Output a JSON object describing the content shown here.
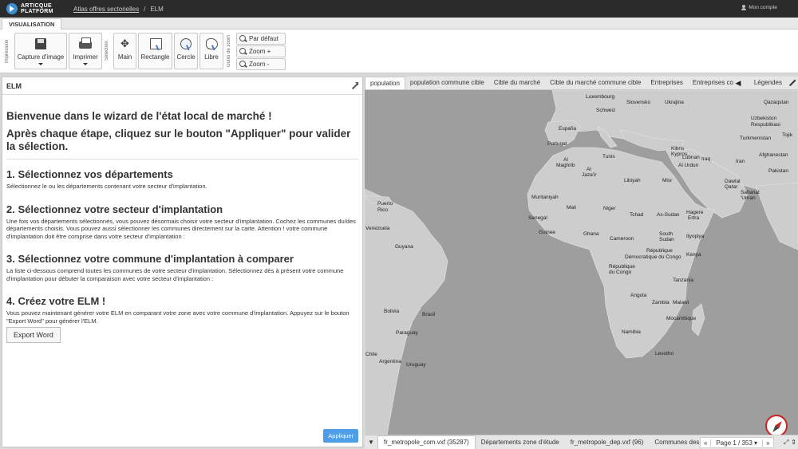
{
  "topbar": {
    "logo_line1": "ARTICQUE",
    "logo_line2": "PLATFORM",
    "breadcrumb": [
      "Atlas offres sectorielles",
      "/",
      "ELM"
    ],
    "account": "Mon compte"
  },
  "ribbon": {
    "tab": "VISUALISATION",
    "group_print": "Impression",
    "group_selection": "Sélection",
    "group_zoom": "Outils de zoom",
    "capture": "Capture d'image",
    "print": "Imprimer",
    "main": "Main",
    "rectangle": "Rectangle",
    "cercle": "Cercle",
    "libre": "Libre",
    "zoom_default": "Par défaut",
    "zoom_in": "Zoom +",
    "zoom_out": "Zoom -"
  },
  "panel": {
    "title": "ELM",
    "welcome": "Bienvenue dans le wizard de l'état local de marché !",
    "instructions": "Après chaque étape, cliquez sur le bouton \"Appliquer\" pour valider la sélection.",
    "steps": [
      {
        "title": "1. Sélectionnez vos départements",
        "text": "Sélectionnez le ou les départements contenant votre secteur d'implantation."
      },
      {
        "title": "2. Sélectionnez votre secteur d'implantation",
        "text": "Une fois vos départements sélectionnés, vous pouvez désormais choisir votre secteur d'implantation. Cochez les communes du/des départements choisis. Vous pouvez aussi sélectionner les communes directement sur la carte. Attention ! votre commune d'implantation doit être comprise dans votre secteur d'implantation :"
      },
      {
        "title": "3. Sélectionnez votre commune d'implantation à comparer",
        "text": "La liste ci-dessous comprend toutes les communes de votre secteur d'implantation. Sélectionnez dès à présent votre commune d'implantation pour débuter la comparaison avec votre secteur d'implantation :"
      },
      {
        "title": "4. Créez votre ELM !",
        "text": "Vous pouvez maintenant générer votre ELM en comparant votre zone avec votre commune d'implantation. Appuyez sur le bouton \"Export Word\" pour générer l'ELM."
      }
    ],
    "export_label": "Export Word",
    "apply_label": "Appliquer"
  },
  "map_tabs": [
    "population",
    "population commune cible",
    "Cible du marché",
    "Cible du marché commune cible",
    "Entreprises",
    "Entreprises co"
  ],
  "legend_tab": "Légendes",
  "places": [
    {
      "name": "Luxembourg"
    },
    {
      "name": "Slovensko"
    },
    {
      "name": "Ukrajina"
    },
    {
      "name": "Qazaqstan"
    },
    {
      "name": "Schweiz"
    },
    {
      "name": "Uzbekiston"
    },
    {
      "name": "Respublikasi"
    },
    {
      "name": "España"
    },
    {
      "name": "Turkmenistan"
    },
    {
      "name": "Tojik"
    },
    {
      "name": "Portugal"
    },
    {
      "name": "Kibris"
    },
    {
      "name": "Kypros"
    },
    {
      "name": "Afghanestan"
    },
    {
      "name": "Tunis"
    },
    {
      "name": "Lubnan"
    },
    {
      "name": "Al"
    },
    {
      "name": "Maghrib"
    },
    {
      "name": "Al Urdun"
    },
    {
      "name": "Iraq"
    },
    {
      "name": "Iran"
    },
    {
      "name": "Al"
    },
    {
      "name": "Jaza'ir"
    },
    {
      "name": "Pakistan"
    },
    {
      "name": "Libiyah"
    },
    {
      "name": "Misr"
    },
    {
      "name": "Dawlat"
    },
    {
      "name": "Qatar"
    },
    {
      "name": "Saltanat"
    },
    {
      "name": "'Uman"
    },
    {
      "name": "Puerto"
    },
    {
      "name": "Rico"
    },
    {
      "name": "Muritaniyah"
    },
    {
      "name": "Mali"
    },
    {
      "name": "Niger"
    },
    {
      "name": "Senegal"
    },
    {
      "name": "Tchad"
    },
    {
      "name": "As-Sudan"
    },
    {
      "name": "Hagere"
    },
    {
      "name": "Ertra"
    },
    {
      "name": "Venezuela"
    },
    {
      "name": "Guinee"
    },
    {
      "name": "Ghana"
    },
    {
      "name": "South"
    },
    {
      "name": "Sudan"
    },
    {
      "name": "Cameroon"
    },
    {
      "name": "Ityopiya"
    },
    {
      "name": "Guyana"
    },
    {
      "name": "République"
    },
    {
      "name": "Démocratique du Congo"
    },
    {
      "name": "Kenya"
    },
    {
      "name": "République"
    },
    {
      "name": "du Congo"
    },
    {
      "name": "Tanzania"
    },
    {
      "name": "Angola"
    },
    {
      "name": "Zambia"
    },
    {
      "name": "Malawi"
    },
    {
      "name": "Bolivia"
    },
    {
      "name": "Brasil"
    },
    {
      "name": "Mocambique"
    },
    {
      "name": "Paraguay"
    },
    {
      "name": "Namibia"
    },
    {
      "name": "Chile"
    },
    {
      "name": "Lesotho"
    },
    {
      "name": "Argentina"
    },
    {
      "name": "Uruguay"
    }
  ],
  "layer_tabs": [
    "fr_metropole_com.vxf (35287)",
    "Départements zone d'étude",
    "fr_metropole_dep.vxf (96)",
    "Communes des"
  ],
  "pager": {
    "prev": "«",
    "label": "Page 1 / 353 ▾",
    "next": "»"
  },
  "colors": {
    "sea": "#9e9e9e",
    "land": "#cdcdcd",
    "accent": "#4d9ee6",
    "topbar": "#2b2b2b"
  }
}
